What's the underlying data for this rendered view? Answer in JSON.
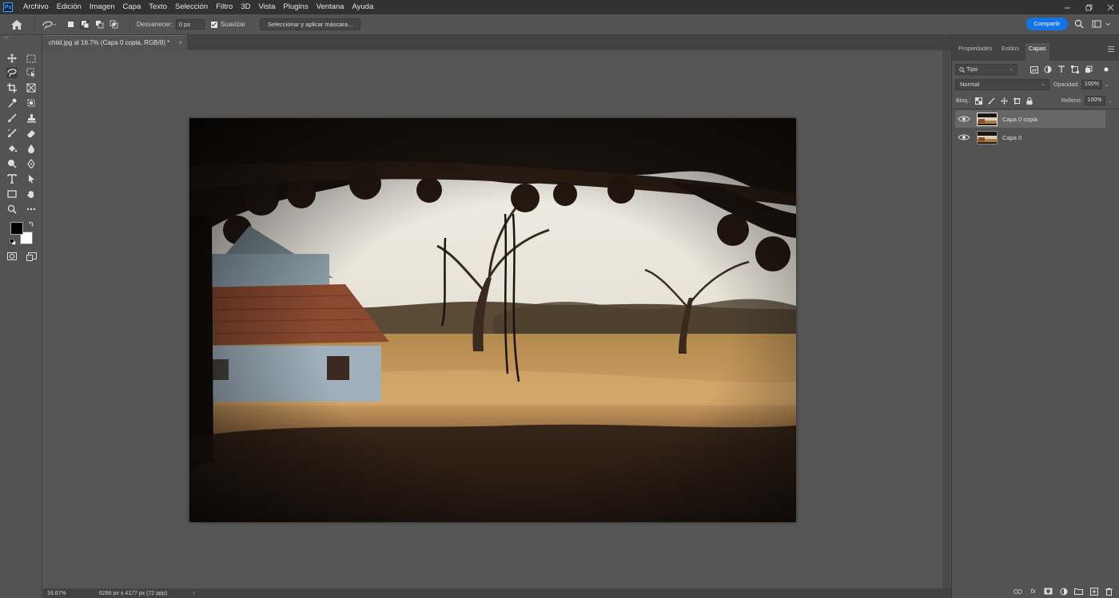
{
  "app": {
    "logo_text": "Ps"
  },
  "menu": [
    "Archivo",
    "Edición",
    "Imagen",
    "Capa",
    "Texto",
    "Selección",
    "Filtro",
    "3D",
    "Vista",
    "Plugins",
    "Ventana",
    "Ayuda"
  ],
  "options": {
    "feather_label": "Desvanecer:",
    "feather_value": "0 px",
    "smooth_label": "Suavizar",
    "mask_button": "Seleccionar y aplicar máscara...",
    "share_button": "Compartir"
  },
  "document": {
    "tab_title": "child.jpg al 16.7% (Capa 0 copia, RGB/8) *",
    "close_symbol": "×"
  },
  "status": {
    "zoom": "16.67%",
    "dimensions": "6266 px x 4177 px (72 ppp)",
    "arrow": "›"
  },
  "panel": {
    "tabs": [
      "Propiedades",
      "Estilos",
      "Capas"
    ],
    "active_tab": "Capas",
    "filter_kind": "Tipo",
    "blend_mode": "Normal",
    "opacity_label": "Opacidad:",
    "opacity_value": "100%",
    "lock_label": "Bloq.:",
    "fill_label": "Relleno:",
    "fill_value": "100%",
    "layers": [
      {
        "name": "Capa 0 copia",
        "visible": true,
        "selected": true
      },
      {
        "name": "Capa 0",
        "visible": true,
        "selected": false
      }
    ]
  },
  "colors": {
    "accent": "#1473e6",
    "foreground": "#000000",
    "background": "#ffffff"
  }
}
